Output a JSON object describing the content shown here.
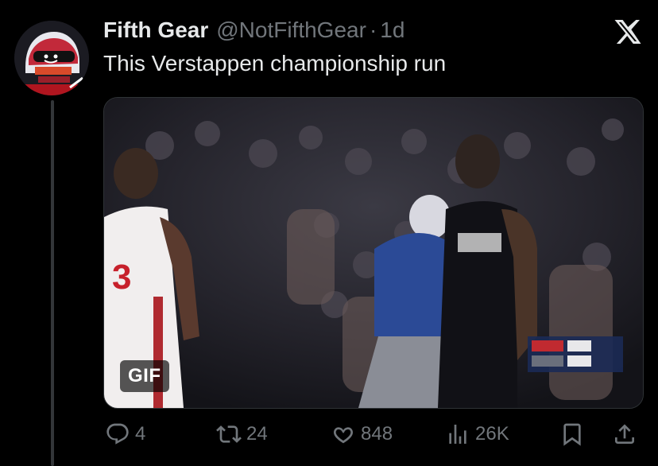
{
  "tweet": {
    "display_name": "Fifth Gear",
    "handle": "@NotFifthGear",
    "separator": "·",
    "time": "1d",
    "text": "This Verstappen championship run"
  },
  "media": {
    "badge": "GIF",
    "jersey_text": "3"
  },
  "actions": {
    "replies": "4",
    "reposts": "24",
    "likes": "848",
    "views": "26K"
  },
  "icons": {
    "brand": "x-logo-icon",
    "reply": "reply-icon",
    "repost": "repost-icon",
    "like": "heart-icon",
    "views": "views-icon",
    "bookmark": "bookmark-icon",
    "share": "share-icon"
  },
  "colors": {
    "background": "#000000",
    "text": "#e7e9ea",
    "muted": "#71767b",
    "divider": "#333639"
  }
}
